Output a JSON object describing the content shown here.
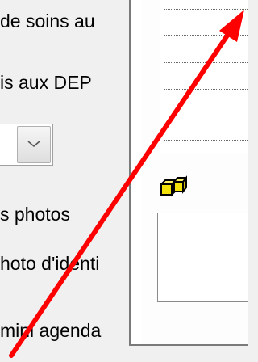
{
  "labels": {
    "soins": "de soins au",
    "dep": "is aux DEP",
    "photos": "s photos",
    "identite": "hoto d'identi",
    "agenda": "mini agenda"
  },
  "dropdown": {
    "selected": "",
    "icon": "chevron-down-icon"
  },
  "side_panel": {
    "icon": "yellow-cubes-icon",
    "list_rows": 7
  },
  "annotation": {
    "color": "#ff0000",
    "shape": "arrow"
  }
}
